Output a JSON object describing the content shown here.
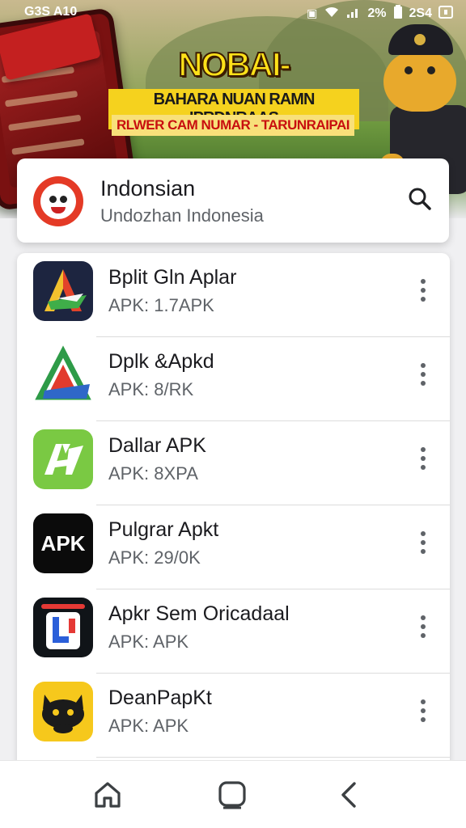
{
  "status_bar": {
    "left_text": "G3S A10",
    "battery_pct": "2%",
    "right_text": "2S4",
    "icons": [
      "screenshot-icon",
      "wifi-icon",
      "signal-icon",
      "battery-icon"
    ]
  },
  "banner": {
    "headline": "NOBAI- INDONDIAI",
    "subline_1": "BAHARA NUAN RAMN IPRDNRAAS",
    "subline_2": "RLWER CAM NUMAR - TARUNRAIPAI",
    "colors": {
      "headline": "#ffe119",
      "subline_2": "#c80f0f"
    }
  },
  "header": {
    "title": "Indonsian",
    "subtitle": "Undozhan Indonesia",
    "search_icon": "search-icon"
  },
  "apps": [
    {
      "name": "Bplit Gln Aplar",
      "meta": "APK: 1.7APK",
      "icon": "stylized-a-logo-dark"
    },
    {
      "name": "Dplk &Apkd",
      "meta": "APK: 8/RK",
      "icon": "triangle-logo-white"
    },
    {
      "name": "Dallar APK",
      "meta": "APK: 8XPA",
      "icon": "green-a-logo"
    },
    {
      "name": "Pulgrar Apkt",
      "meta": "APK: 29/0K",
      "icon": "apk-text-logo"
    },
    {
      "name": "Apkr Sem Oricadaal",
      "meta": "APK: APK",
      "icon": "l-tile-logo"
    },
    {
      "name": "DeanPapKt",
      "meta": "APK: APK",
      "icon": "yellow-cat-logo"
    }
  ],
  "navbar": {
    "icons": [
      "home-icon",
      "recents-icon",
      "back-icon"
    ]
  }
}
